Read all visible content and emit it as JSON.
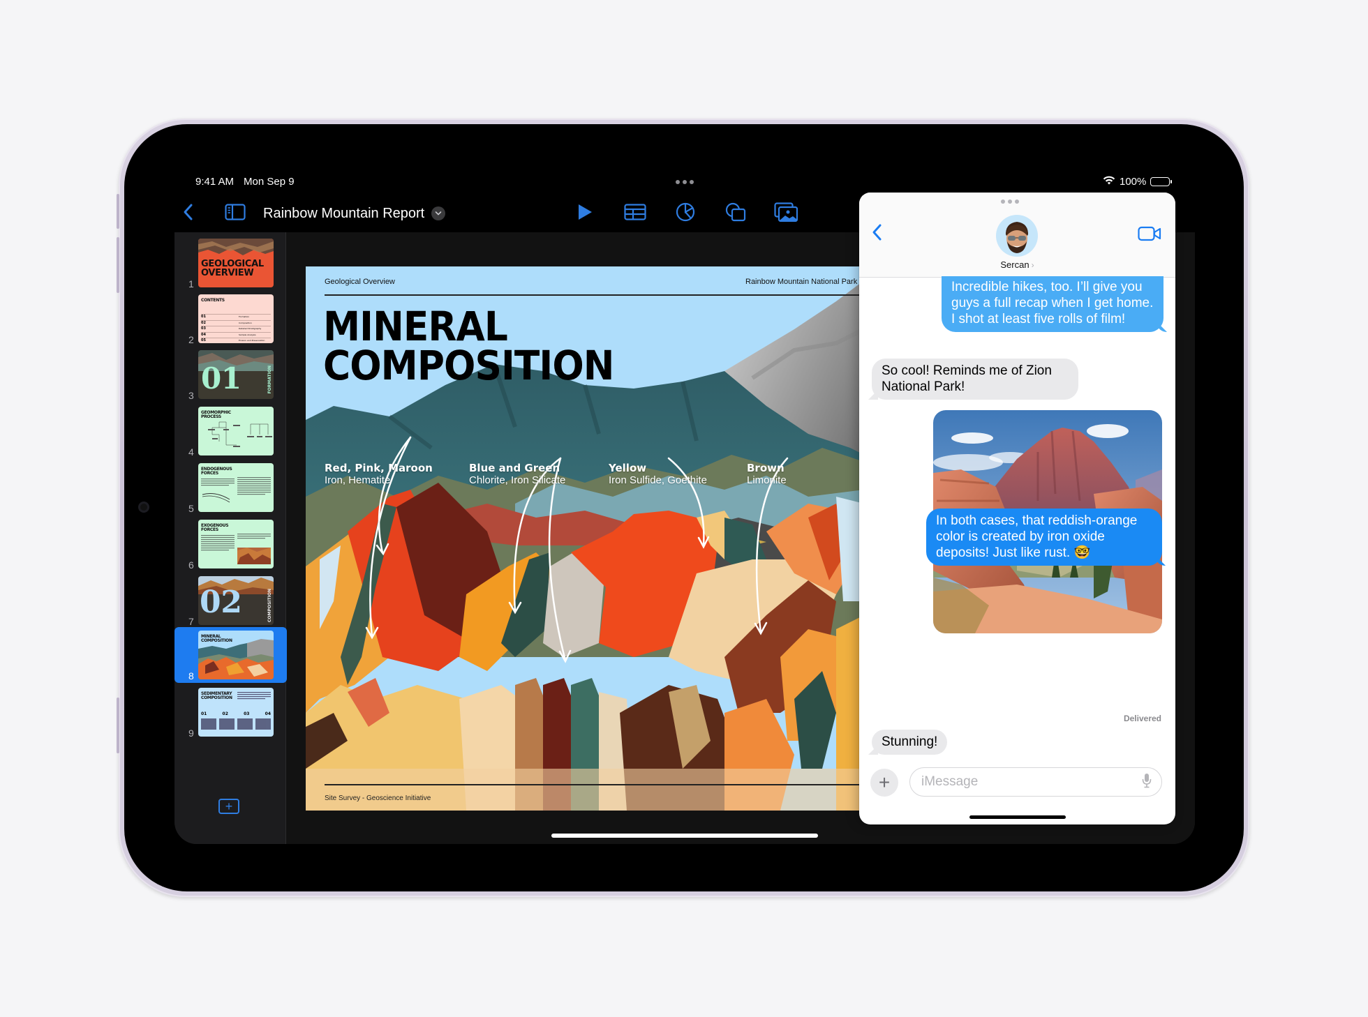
{
  "status_bar": {
    "time": "9:41 AM",
    "date": "Mon Sep 9",
    "battery": "100%",
    "battery_level": 1.0
  },
  "keynote": {
    "document_title": "Rainbow Mountain Report",
    "toolbar": {
      "back_icon": "chevron-left-icon",
      "sidebar_icon": "sidebar-toggle-icon",
      "title_menu_icon": "chevron-down-icon",
      "tools": [
        {
          "name": "play-button",
          "icon": "play-icon"
        },
        {
          "name": "insert-table-button",
          "icon": "table-icon"
        },
        {
          "name": "insert-chart-button",
          "icon": "pie-chart-icon"
        },
        {
          "name": "insert-shape-button",
          "icon": "shapes-icon"
        },
        {
          "name": "insert-media-button",
          "icon": "photo-icon"
        }
      ]
    },
    "slides": [
      {
        "number": "1",
        "title": "GEOLOGICAL OVERVIEW"
      },
      {
        "number": "2",
        "title": "CONTENTS",
        "rows": [
          {
            "num": "01",
            "label": "Formation"
          },
          {
            "num": "02",
            "label": "Composition"
          },
          {
            "num": "03",
            "label": "Detailed Stratigraphy"
          },
          {
            "num": "04",
            "label": "Sample Analysis"
          },
          {
            "num": "05",
            "label": "Erosion and Preservation"
          }
        ]
      },
      {
        "number": "3",
        "title": "01",
        "side": "FORMATION"
      },
      {
        "number": "4",
        "title": "GEOMORPHIC PROCESS"
      },
      {
        "number": "5",
        "title": "ENDOGENOUS FORCES"
      },
      {
        "number": "6",
        "title": "EXOGENOUS FORCES"
      },
      {
        "number": "7",
        "title": "02",
        "side": "COMPOSITION"
      },
      {
        "number": "8",
        "title": "MINERAL COMPOSITION",
        "selected": true
      },
      {
        "number": "9",
        "title": "SEDIMENTARY COMPOSITION",
        "cols": [
          "01",
          "02",
          "03",
          "04"
        ]
      }
    ],
    "add_slide_icon": "plus-icon",
    "current_slide": {
      "header_left": "Geological Overview",
      "header_right": "Rainbow Mountain National Park",
      "title_line1": "MINERAL",
      "title_line2": "COMPOSITION",
      "labels": [
        {
          "color": "Red, Pink, Maroon",
          "mineral": "Iron, Hematite"
        },
        {
          "color": "Blue and Green",
          "mineral": "Chlorite, Iron Silicate"
        },
        {
          "color": "Yellow",
          "mineral": "Iron Sulfide, Goethite"
        },
        {
          "color": "Brown",
          "mineral": "Limonite"
        }
      ],
      "footer": "Site Survey - Geoscience Initiative"
    }
  },
  "messages": {
    "contact": "Sercan",
    "thread": [
      {
        "direction": "out",
        "text": "Incredible hikes, too. I’ll give you guys a full recap when I get home. I shot at least five rolls of film!"
      },
      {
        "direction": "in",
        "text": "So cool! Reminds me of Zion National Park!"
      },
      {
        "direction": "out",
        "type": "photo",
        "description": "Zion canyon landscape illustration"
      },
      {
        "direction": "out",
        "text": "In both cases, that reddish-orange color is created by iron oxide deposits! Just like rust. 🤓"
      },
      {
        "direction": "in",
        "text": "Stunning!"
      }
    ],
    "delivered_label": "Delivered",
    "compose_placeholder": "iMessage",
    "compose_plus_icon": "plus-icon",
    "mic_icon": "microphone-icon",
    "video_icon": "video-camera-icon"
  },
  "colors": {
    "accent": "#2f7de1",
    "selected_slide": "#1e7cf0",
    "bubble_out": "#4aacf5",
    "bubble_out_latest": "#1a8af4",
    "bubble_in": "#e9e9eb",
    "slide_sky": "#aeddfb"
  }
}
